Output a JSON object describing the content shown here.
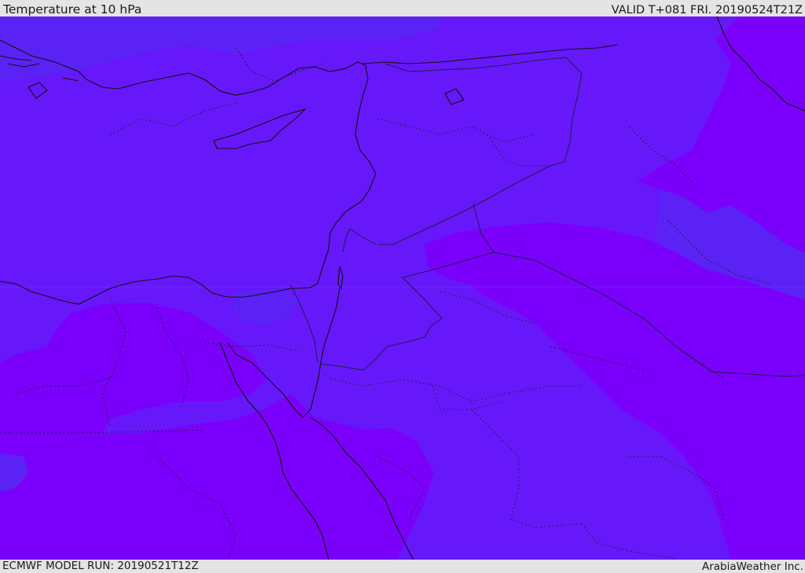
{
  "header": {
    "title": "Temperature at 10 hPa",
    "valid": "VALID T+081 FRI. 20190524T21Z"
  },
  "footer": {
    "model_run": "ECMWF MODEL RUN: 20190521T12Z",
    "credit": "ArabiaWeather Inc."
  },
  "map": {
    "field_colors": {
      "band_blue": "#5a22f4",
      "band_indigo": "#6618fa",
      "band_violet": "#7a00fc"
    },
    "line_colors": {
      "coastline": "#111111",
      "border": "#222255"
    }
  }
}
